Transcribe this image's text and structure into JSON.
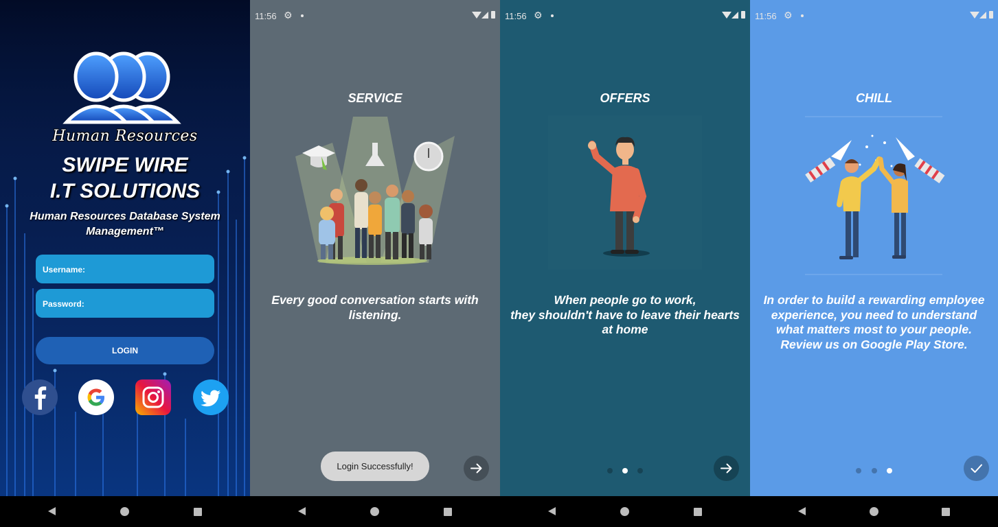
{
  "status_bar": {
    "time": "11:56"
  },
  "login_screen": {
    "logo_caption": "Human Resources",
    "brand_line_1": "SWIPE WIRE",
    "brand_line_2": "I.T SOLUTIONS",
    "subtitle": "Human Resources Database System Management™",
    "username_label": "Username:",
    "password_label": "Password:",
    "login_button": "LOGIN",
    "social": [
      {
        "name": "Facebook",
        "icon": "facebook-icon"
      },
      {
        "name": "Google",
        "icon": "google-icon"
      },
      {
        "name": "Instagram",
        "icon": "instagram-icon"
      },
      {
        "name": "Twitter",
        "icon": "twitter-icon"
      }
    ]
  },
  "onboarding": [
    {
      "title": "SERVICE",
      "text": "Every good conversation starts with listening.",
      "page": 1,
      "background": "#5d6a74",
      "action": "next"
    },
    {
      "title": "OFFERS",
      "text": "When people go to work,\nthey shouldn't have to leave their hearts at home",
      "page": 2,
      "background": "#1e5a71",
      "action": "next"
    },
    {
      "title": "CHILL",
      "text": "In order to build a rewarding employee experience, you need to understand what matters most to your people.\nReview us on Google Play Store.",
      "page": 3,
      "background": "#5b9be7",
      "action": "done"
    }
  ],
  "toast": "Login Successfully!",
  "colors": {
    "login_bg": "#020b26",
    "field": "#1e9ad6",
    "login_button": "#1f61b5"
  }
}
